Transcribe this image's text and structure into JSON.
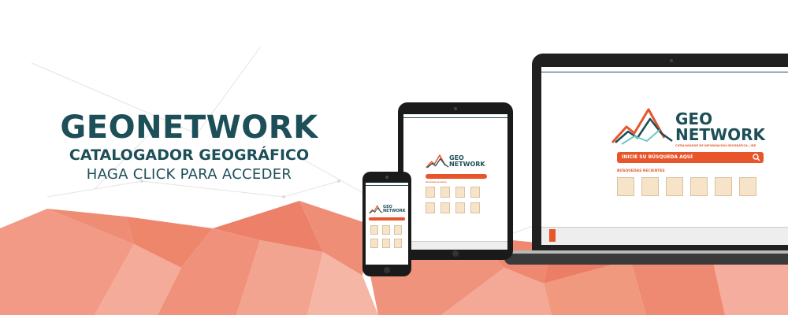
{
  "headline": {
    "title": "GEONETWORK",
    "subtitle": "CATALOGADOR GEOGRÁFICO",
    "cta": "HAGA CLICK PARA ACCEDER"
  },
  "app": {
    "logo_top": "GEO",
    "logo_bottom": "NETWORK",
    "logo_tagline": "CATALOGADOR DE INFORMACIÓN GEOGRÁFICA | IDE",
    "search_placeholder": "INICIE SU BÚSQUEDA AQUÍ",
    "recent_label": "BÚSQUEDAS RECIENTES"
  },
  "colors": {
    "brand": "#1d4f58",
    "accent": "#e8552a",
    "mesh": "#ee8a72"
  },
  "icons": {
    "search": "search-icon",
    "mountain_logo": "mountain-logo-icon"
  }
}
